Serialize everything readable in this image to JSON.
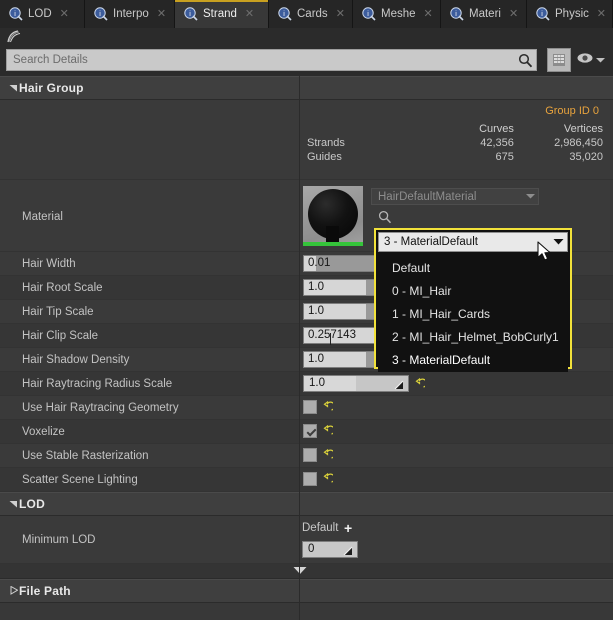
{
  "tabs": [
    {
      "label": "LOD",
      "active": false
    },
    {
      "label": "Interpo",
      "active": false
    },
    {
      "label": "Strand",
      "active": true
    },
    {
      "label": "Cards",
      "active": false
    },
    {
      "label": "Meshe",
      "active": false
    },
    {
      "label": "Materi",
      "active": false
    },
    {
      "label": "Physic",
      "active": false
    }
  ],
  "toolbar": {
    "search_placeholder": "Search Details",
    "search_value": "",
    "grid_button": "column-view-button",
    "eye_button": "view-options-button"
  },
  "sections": {
    "hair_group": {
      "title": "Hair Group",
      "expanded": true,
      "group_id": "Group ID 0",
      "stats": {
        "columns": [
          "Curves",
          "Vertices"
        ],
        "rows": [
          {
            "label": "Strands",
            "curves": "42,356",
            "vertices": "2,986,450"
          },
          {
            "label": "Guides",
            "curves": "675",
            "vertices": "35,020"
          }
        ]
      },
      "material": {
        "label": "Material",
        "asset_name": "HairDefaultMaterial"
      },
      "properties": [
        {
          "label": "Hair Width",
          "value": "0.01",
          "type": "number",
          "fill": 12
        },
        {
          "label": "Hair Root Scale",
          "value": "1.0",
          "type": "number",
          "fill": 60
        },
        {
          "label": "Hair Tip Scale",
          "value": "1.0",
          "type": "number",
          "fill": 60
        },
        {
          "label": "Hair Clip Scale",
          "value": "0.257143",
          "type": "number",
          "fill": 101
        },
        {
          "label": "Hair Shadow Density",
          "value": "1.0",
          "type": "number",
          "fill": 60
        },
        {
          "label": "Hair Raytracing Radius Scale",
          "value": "1.0",
          "type": "spin",
          "fill": 50
        },
        {
          "label": "Use Hair Raytracing Geometry",
          "value": false,
          "type": "checkbox"
        },
        {
          "label": "Voxelize",
          "value": true,
          "type": "checkbox"
        },
        {
          "label": "Use Stable Rasterization",
          "value": false,
          "type": "checkbox"
        },
        {
          "label": "Scatter Scene Lighting",
          "value": false,
          "type": "checkbox"
        }
      ]
    },
    "lod": {
      "title": "LOD",
      "expanded": true,
      "minimum_lod": {
        "label": "Minimum LOD",
        "default_label": "Default",
        "value": "0"
      }
    },
    "file_path": {
      "title": "File Path",
      "expanded": false
    }
  },
  "dropdown": {
    "selected": "3 - MaterialDefault",
    "options": [
      "Default",
      "0 - MI_Hair",
      "1 - MI_Hair_Cards",
      "2 - MI_Hair_Helmet_BobCurly1",
      "3 - MaterialDefault"
    ]
  },
  "colors": {
    "accent_yellow": "#f2e23a",
    "group_id_orange": "#e8a33d",
    "active_tab_underline": "#c8a020",
    "reset_arrow": "#d8cf3a",
    "thumbnail_bar_green": "#35c43a"
  }
}
